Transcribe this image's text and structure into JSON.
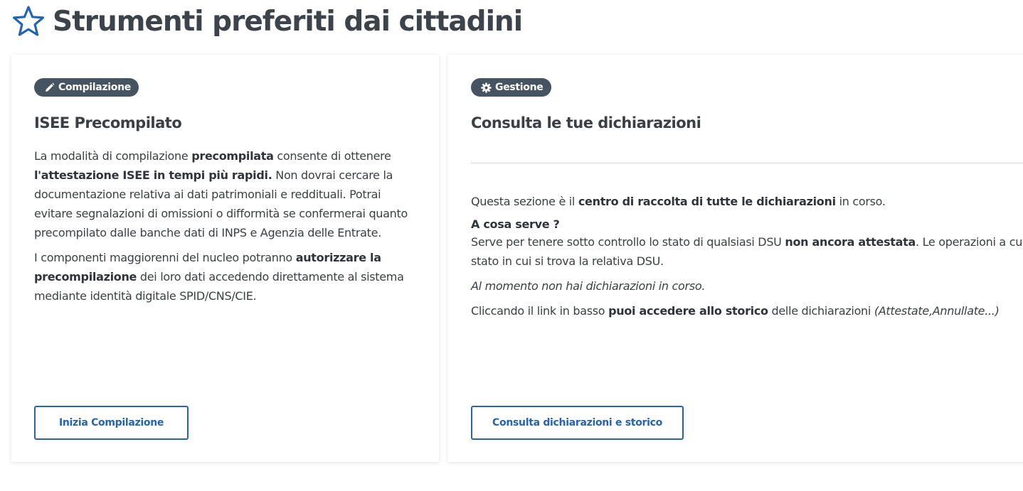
{
  "header": {
    "title": "Strumenti preferiti dai cittadini",
    "icon": "star-icon",
    "icon_color": "#2563b3"
  },
  "cards": [
    {
      "badge": {
        "label": "Compilazione",
        "icon": "pencil-icon"
      },
      "title": "ISEE Precompilato",
      "paragraphs": [
        {
          "t1": "La modalità di compilazione ",
          "b1": "precompilata",
          "t2": " consente di ottenere ",
          "b2": "l'attestazione ISEE in tempi più rapidi.",
          "t3": " Non dovrai cercare la documentazione relativa ai dati patrimoniali e reddituali. Potrai evitare segnalazioni di omissioni o difformità se confermerai quanto precompilato dalle banche dati di INPS e Agenzia delle Entrate."
        },
        {
          "t1": "I componenti maggiorenni del nucleo potranno ",
          "b1": "autorizzare la precompilazione",
          "t2": " dei loro dati accedendo direttamente al sistema mediante identità digitale SPID/CNS/CIE."
        }
      ],
      "button_label": "Inizia Compilazione"
    },
    {
      "badge": {
        "label": "Gestione",
        "icon": "gear-icon"
      },
      "title": "Consulta le tue dichiarazioni",
      "intro": {
        "t1": "Questa sezione è il ",
        "b1": "centro di raccolta di tutte le dichiarazioni",
        "t2": " in corso."
      },
      "section_heading": "A cosa serve ?",
      "purpose": {
        "t1": "Serve per tenere sotto controllo lo stato di qualsiasi DSU ",
        "b1": "non ancora attestata",
        "t2": ". Le operazioni a cui si ha",
        "t3": "stato in cui si trova la relativa DSU."
      },
      "status_note": "Al momento non hai dichiarazioni in corso.",
      "history": {
        "t1": "Cliccando il link in basso ",
        "b1": "puoi accedere allo storico",
        "t2": " delle dichiarazioni ",
        "i1": "(Attestate,Annullate...)"
      },
      "button_label": "Consulta dichiarazioni e storico"
    }
  ],
  "colors": {
    "accent": "#2563b3",
    "badge_bg": "#455460",
    "text": "#3b3f44"
  }
}
